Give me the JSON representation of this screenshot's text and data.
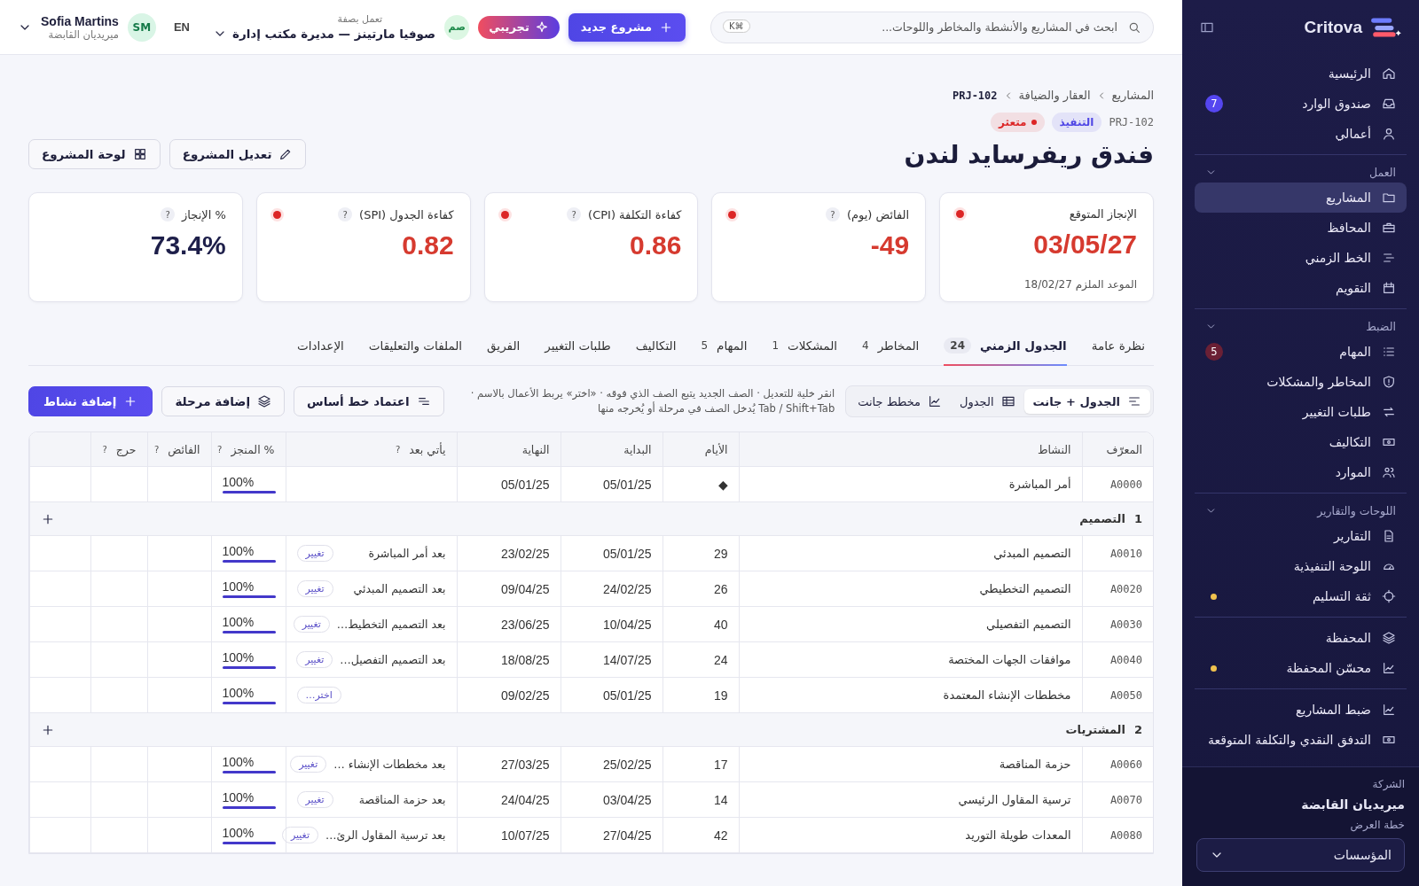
{
  "sidebar": {
    "brand": "Critova",
    "sections": [
      {
        "items": [
          {
            "kind": "home",
            "label": "الرئيسية",
            "selected": false
          },
          {
            "kind": "inbox",
            "label": "صندوق الوارد",
            "selected": false,
            "badge": {
              "text": "7",
              "color": "#5546f0"
            }
          },
          {
            "kind": "user",
            "label": "أعمالي",
            "selected": false
          }
        ]
      },
      {
        "heading": "العمل",
        "expanded": true,
        "items": [
          {
            "kind": "folder",
            "label": "المشاريع",
            "selected": true
          },
          {
            "kind": "briefcase",
            "label": "المحافظ",
            "selected": false
          },
          {
            "kind": "timeline",
            "label": "الخط الزمني",
            "selected": false
          },
          {
            "kind": "calendar",
            "label": "التقويم",
            "selected": false
          }
        ]
      },
      {
        "heading": "الضبط",
        "expanded": true,
        "items": [
          {
            "kind": "list",
            "label": "المهام",
            "selected": false,
            "badge": {
              "text": "5",
              "color": "#6b2035"
            }
          },
          {
            "kind": "shield",
            "label": "المخاطر والمشكلات",
            "selected": false
          },
          {
            "kind": "swap",
            "label": "طلبات التغيير",
            "selected": false
          },
          {
            "kind": "money",
            "label": "التكاليف",
            "selected": false
          },
          {
            "kind": "users",
            "label": "الموارد",
            "selected": false
          }
        ]
      },
      {
        "heading": "اللوحات والتقارير",
        "expanded": true,
        "items": [
          {
            "kind": "doc",
            "label": "التقارير",
            "selected": false
          },
          {
            "kind": "gauge",
            "label": "اللوحة التنفيذية",
            "selected": false
          },
          {
            "kind": "target",
            "label": "ثقة التسليم",
            "selected": false,
            "dot": true
          }
        ]
      },
      {
        "items": [
          {
            "kind": "layers",
            "label": "المحفظة",
            "selected": false
          },
          {
            "kind": "chart",
            "label": "محسّن المحفظة",
            "selected": false,
            "dot": true
          }
        ]
      },
      {
        "items": [
          {
            "kind": "chart",
            "label": "ضبط المشاريع",
            "selected": false
          },
          {
            "kind": "money",
            "label": "التدفق النقدي والتكلفة المتوقعة",
            "selected": false
          }
        ]
      }
    ],
    "footer": {
      "company_label": "الشركة",
      "company": "ميريديان القابضة",
      "plan_label": "خطة العرض",
      "plan": "المؤسسات"
    }
  },
  "topbar": {
    "search": {
      "placeholder": "ابحث في المشاريع والأنشطة والمخاطر واللوحات...",
      "shortcut": "K⌘"
    },
    "new_project": "مشروع جديد",
    "trial": "تجريبي",
    "acting_as": {
      "label": "تعمل بصفة",
      "name": "صوفيا مارتينز — مديرة مكتب إدارة",
      "initials": "صم"
    },
    "language": "EN",
    "user": {
      "initials": "SM",
      "name": "Sofia Martins",
      "org": "ميريديان القابضة"
    }
  },
  "header": {
    "breadcrumb": [
      "المشاريع",
      "العقار والضيافة",
      "PRJ-102"
    ],
    "code": "PRJ-102",
    "tags": [
      {
        "text": "التنفيذ",
        "color": "#4f46e5",
        "dot": false
      },
      {
        "text": "متعثر",
        "color": "#dc2626",
        "dot": true
      }
    ],
    "title": "فندق ريفرسايد لندن",
    "buttons": [
      {
        "kind": "pencil",
        "label": "تعديل المشروع"
      },
      {
        "kind": "grid",
        "label": "لوحة المشروع"
      }
    ]
  },
  "kpis": [
    {
      "label": "الإنجاز المتوقع",
      "value": "03/05/27",
      "alert": true,
      "sub": "الموعد الملزم 18/02/27"
    },
    {
      "label": "الفائض (يوم)",
      "help": "?",
      "value": "-49",
      "alert": true
    },
    {
      "label": "كفاءة التكلفة (CPI)",
      "help": "?",
      "value": "0.86",
      "alert": true
    },
    {
      "label": "كفاءة الجدول (SPI)",
      "help": "?",
      "value": "0.82",
      "alert": true
    },
    {
      "label": "% الإنجاز",
      "help": "?",
      "value": "73.4%",
      "alert": false
    }
  ],
  "tabs": [
    {
      "label": "نظرة عامة",
      "selected": false
    },
    {
      "label": "الجدول الزمني",
      "count": "24",
      "selected": true
    },
    {
      "label": "المخاطر",
      "count": "4",
      "selected": false
    },
    {
      "label": "المشكلات",
      "count": "1",
      "selected": false
    },
    {
      "label": "المهام",
      "count": "5",
      "selected": false
    },
    {
      "label": "التكاليف",
      "selected": false
    },
    {
      "label": "طلبات التغيير",
      "selected": false
    },
    {
      "label": "الفريق",
      "selected": false
    },
    {
      "label": "الملفات والتعليقات",
      "selected": false
    },
    {
      "label": "الإعدادات",
      "selected": false
    }
  ],
  "toolbar": {
    "views": [
      {
        "kind": "split",
        "label": "الجدول + جانت",
        "selected": true
      },
      {
        "kind": "table",
        "label": "الجدول",
        "selected": false
      },
      {
        "kind": "chart",
        "label": "مخطط جانت",
        "selected": false
      }
    ],
    "hint": "انقر خلية للتعديل · الصف الجديد يتبع الصف الذي فوقه · «اختر» يربط الأعمال بالاسم · Tab / Shift+Tab يُدخل الصف في مرحلة أو يُخرجه منها",
    "buttons": [
      {
        "kind": "baseline",
        "label": "اعتماد خط أساس",
        "primary": false
      },
      {
        "kind": "layers",
        "label": "إضافة مرحلة",
        "primary": false
      },
      {
        "kind": "plus",
        "label": "إضافة نشاط",
        "primary": true
      }
    ]
  },
  "table": {
    "columns": [
      {
        "label": "المعرّف"
      },
      {
        "label": "النشاط"
      },
      {
        "label": "الأيام"
      },
      {
        "label": "البداية"
      },
      {
        "label": "النهاية"
      },
      {
        "label": "يأتي بعد",
        "help": "?"
      },
      {
        "label": "% المنجز",
        "help": "?"
      },
      {
        "label": "الفائض",
        "help": "?"
      },
      {
        "label": "حرج",
        "help": "?"
      },
      {}
    ],
    "rows": [
      {
        "kind": "activity",
        "id": "A0000",
        "name": "أمر المباشرة",
        "days": "◆",
        "start": "05/01/25",
        "end": "05/01/25",
        "done": "100%",
        "level": 1
      },
      {
        "kind": "phase",
        "number": "1",
        "name": "التصميم"
      },
      {
        "kind": "activity",
        "id": "A0010",
        "name": "التصميم المبدئي",
        "days": "29",
        "start": "05/01/25",
        "end": "23/02/25",
        "after": "بعد أمر المباشرة",
        "link": "تغيير",
        "done": "100%",
        "level": 1
      },
      {
        "kind": "activity",
        "id": "A0020",
        "name": "التصميم التخطيطي",
        "days": "26",
        "start": "24/02/25",
        "end": "09/04/25",
        "after": "بعد التصميم المبدئي",
        "link": "تغيير",
        "done": "100%",
        "level": 1
      },
      {
        "kind": "activity",
        "id": "A0030",
        "name": "التصميم التفصيلي",
        "days": "40",
        "start": "10/04/25",
        "end": "23/06/25",
        "after": "بعد التصميم التخطيط…",
        "link": "تغيير",
        "done": "100%",
        "level": 1
      },
      {
        "kind": "activity",
        "id": "A0040",
        "name": "موافقات الجهات المختصة",
        "days": "24",
        "start": "14/07/25",
        "end": "18/08/25",
        "after": "بعد التصميم التفصيل…",
        "link": "تغيير",
        "done": "100%",
        "level": 1
      },
      {
        "kind": "activity",
        "id": "A0050",
        "name": "مخططات الإنشاء المعتمدة",
        "days": "19",
        "start": "05/01/25",
        "end": "09/02/25",
        "link": "اختر…",
        "done": "100%",
        "level": 1
      },
      {
        "kind": "phase",
        "number": "2",
        "name": "المشتريات"
      },
      {
        "kind": "activity",
        "id": "A0060",
        "name": "حزمة المناقصة",
        "days": "17",
        "start": "25/02/25",
        "end": "27/03/25",
        "after": "بعد مخططات الإنشاء …",
        "link": "تغيير",
        "done": "100%",
        "level": 1
      },
      {
        "kind": "activity",
        "id": "A0070",
        "name": "ترسية المقاول الرئيسي",
        "days": "14",
        "start": "03/04/25",
        "end": "24/04/25",
        "after": "بعد حزمة المناقصة",
        "link": "تغيير",
        "done": "100%",
        "level": 1
      },
      {
        "kind": "activity",
        "id": "A0080",
        "name": "المعدات طويلة التوريد",
        "days": "42",
        "start": "27/04/25",
        "end": "10/07/25",
        "after": "بعد ترسية المقاول الرئ…",
        "link": "تغيير",
        "done": "100%",
        "level": 1
      }
    ]
  }
}
